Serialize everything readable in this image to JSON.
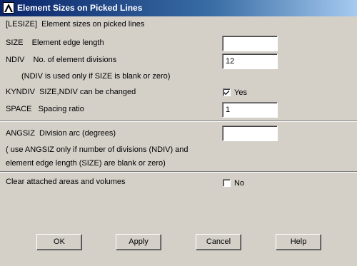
{
  "window": {
    "title": "Element Sizes on Picked Lines",
    "icon": "ansys-logo-icon"
  },
  "header": {
    "text": "[LESIZE]  Element sizes on picked lines"
  },
  "size": {
    "label": "SIZE    Element edge length",
    "value": ""
  },
  "ndiv": {
    "label": "NDIV    No. of element divisions",
    "value": "12",
    "note": "(NDIV is used only if SIZE is blank or zero)"
  },
  "kyndiv": {
    "label": "KYNDIV  SIZE,NDIV can be changed",
    "checked": true,
    "state_label": "Yes"
  },
  "space": {
    "label": "SPACE   Spacing ratio",
    "value": "1"
  },
  "angsiz": {
    "label": "ANGSIZ  Division arc (degrees)",
    "value": "",
    "note1": "( use ANGSIZ only if number of divisions (NDIV) and",
    "note2": "element edge length (SIZE) are blank or zero)"
  },
  "clear": {
    "label": "Clear attached areas and volumes",
    "checked": false,
    "state_label": "No"
  },
  "buttons": {
    "ok": "OK",
    "apply": "Apply",
    "cancel": "Cancel",
    "help": "Help"
  }
}
